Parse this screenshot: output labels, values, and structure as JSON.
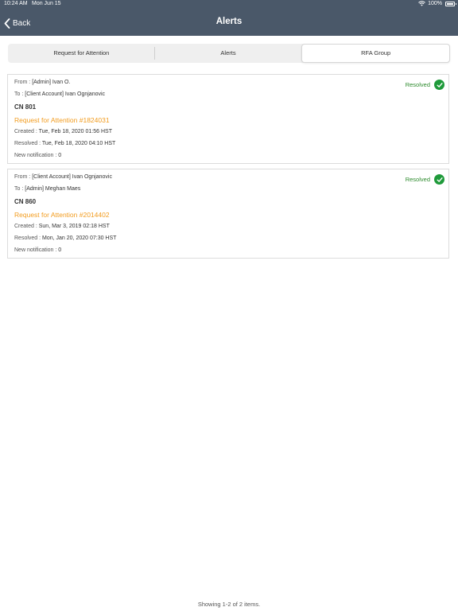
{
  "status_bar": {
    "time": "10:24 AM",
    "date": "Mon Jun 15",
    "battery": "100%"
  },
  "nav": {
    "back_label": "Back",
    "title": "Alerts"
  },
  "tabs": [
    {
      "label": "Request for Attention",
      "selected": false
    },
    {
      "label": "Alerts",
      "selected": false
    },
    {
      "label": "RFA Group",
      "selected": true
    }
  ],
  "labels": {
    "from": "From :",
    "to": "To :",
    "created": "Created :",
    "resolved": "Resolved :",
    "new_notification": "New notification :"
  },
  "alerts": [
    {
      "from": "[Admin] Ivan O.",
      "to": "[Client Account] Ivan Ognjanovic",
      "cn": "CN 801",
      "rfa": "Request for Attention #1824031",
      "created": "Tue, Feb 18, 2020 01:56 HST",
      "resolved": "Tue, Feb 18, 2020 04:10 HST",
      "new_notification": "0",
      "status": "Resolved"
    },
    {
      "from": "[Client Account] Ivan Ognjanovic",
      "to": "[Admin] Meghan Maes",
      "cn": "CN 860",
      "rfa": "Request for Attention #2014402",
      "created": "Sun, Mar 3, 2019 02:18 HST",
      "resolved": "Mon, Jan 20, 2020 07:30 HST",
      "new_notification": "0",
      "status": "Resolved"
    }
  ],
  "footer": {
    "count_text": "Showing 1-2 of 2 items."
  },
  "colors": {
    "nav_bg": "#4a5869",
    "link": "#f29b1d",
    "resolved": "#2e8b2e",
    "check": "#1f9a3a"
  }
}
